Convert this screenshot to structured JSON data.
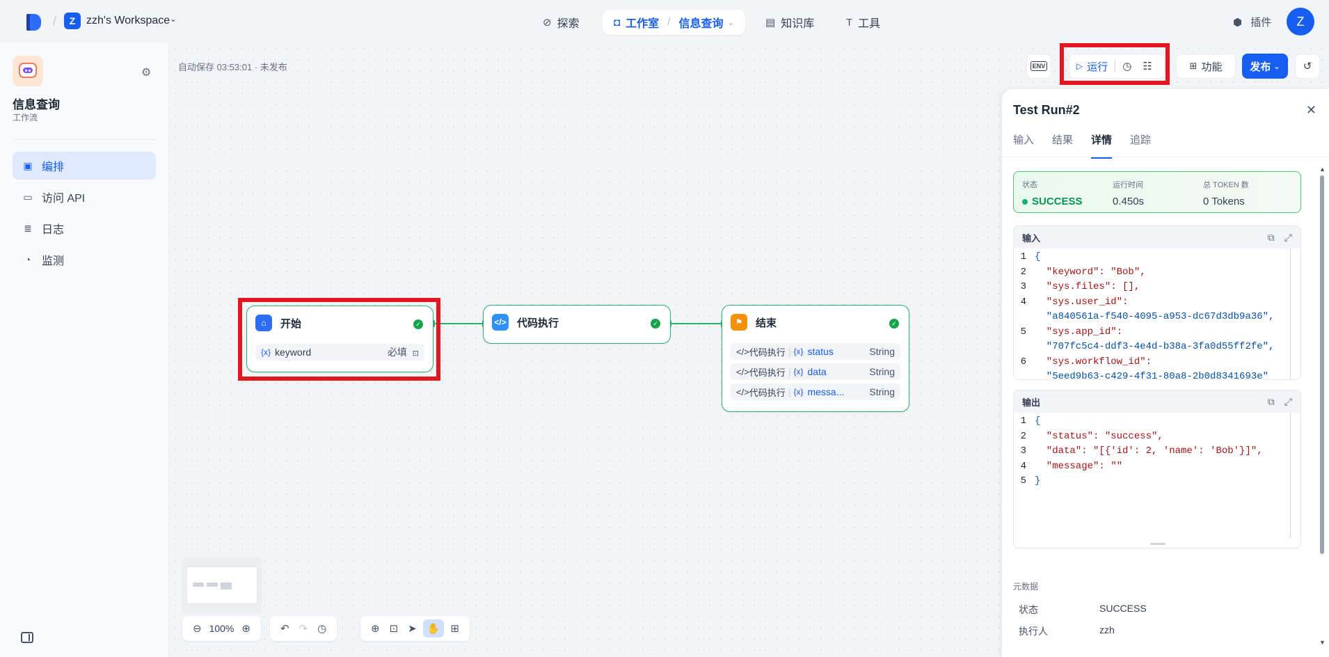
{
  "header": {
    "workspace_initial": "Z",
    "workspace_name": "zzh's Workspace",
    "nav": {
      "explore": "探索",
      "studio": "工作室",
      "current_app": "信息查询",
      "knowledge": "知识库",
      "tools": "工具"
    },
    "plugin": "插件",
    "user_initial": "Z"
  },
  "sidebar": {
    "app_name": "信息查询",
    "app_type": "工作流",
    "items": [
      {
        "label": "编排",
        "icon": "layout-icon",
        "active": true
      },
      {
        "label": "访问 API",
        "icon": "terminal-icon",
        "active": false
      },
      {
        "label": "日志",
        "icon": "log-icon",
        "active": false
      },
      {
        "label": "监测",
        "icon": "monitor-icon",
        "active": false
      }
    ]
  },
  "canvas": {
    "autosave": "自动保存 03:53:01 · 未发布",
    "zoom": "100%"
  },
  "toolbar": {
    "env_label": "ENV",
    "run_label": "运行",
    "features_label": "功能",
    "publish_label": "发布"
  },
  "nodes": {
    "start": {
      "title": "开始",
      "field_var": "{x}",
      "field_name": "keyword",
      "field_required": "必填"
    },
    "code": {
      "title": "代码执行"
    },
    "end": {
      "title": "结束",
      "outputs": [
        {
          "source": "代码执行",
          "var": "{x}",
          "name": "status",
          "type": "String"
        },
        {
          "source": "代码执行",
          "var": "{x}",
          "name": "data",
          "type": "String"
        },
        {
          "source": "代码执行",
          "var": "{x}",
          "name": "messa...",
          "type": "String"
        }
      ]
    }
  },
  "panel": {
    "title": "Test Run#2",
    "tabs": [
      "输入",
      "结果",
      "详情",
      "追踪"
    ],
    "active_tab": "详情",
    "status": {
      "status_label": "状态",
      "status_value": "SUCCESS",
      "time_label": "运行时间",
      "time_value": "0.450s",
      "token_label": "总 TOKEN 数",
      "token_value": "0 Tokens"
    },
    "input": {
      "label": "输入",
      "line_numbers": [
        "1",
        "2",
        "3",
        "4",
        "",
        "5",
        "",
        "6",
        ""
      ],
      "lines": [
        "{",
        "  \"keyword\": \"Bob\",",
        "  \"sys.files\": [],",
        "  \"sys.user_id\":",
        "  \"a840561a-f540-4095-a953-dc67d3db9a36\",",
        "  \"sys.app_id\":",
        "  \"707fc5c4-ddf3-4e4d-b38a-3fa0d55ff2fe\",",
        "  \"sys.workflow_id\":",
        "  \"5eed9b63-c429-4f31-80a8-2b0d8341693e\""
      ]
    },
    "output": {
      "label": "输出",
      "line_numbers": [
        "1",
        "2",
        "3",
        "4",
        "5"
      ],
      "lines": [
        "{",
        "  \"status\": \"success\",",
        "  \"data\": \"[{'id': 2, 'name': 'Bob'}]\",",
        "  \"message\": \"\"",
        "}"
      ]
    },
    "metadata": {
      "title": "元数据",
      "rows": [
        {
          "key": "状态",
          "value": "SUCCESS"
        },
        {
          "key": "执行人",
          "value": "zzh"
        }
      ]
    }
  },
  "colors": {
    "accent": "#155eef",
    "success": "#17b26a",
    "highlight": "#e3171f"
  }
}
